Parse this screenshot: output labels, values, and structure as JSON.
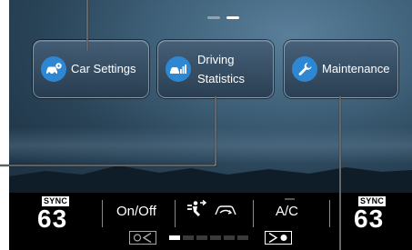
{
  "home": {
    "tiles": [
      {
        "label": "Car Settings",
        "icon": "car-gear-icon"
      },
      {
        "line1": "Driving",
        "line2": "Statistics",
        "icon": "car-bar-chart-icon"
      },
      {
        "label": "Maintenance",
        "icon": "wrench-icon"
      }
    ],
    "page_indicator": {
      "pages": 2,
      "current": 2
    }
  },
  "climate": {
    "left": {
      "sync": "SYNC",
      "temp": "63"
    },
    "right": {
      "sync": "SYNC",
      "temp": "63"
    },
    "onoff_label": "On/Off",
    "ac_label": "A/C",
    "fan_level": 0.167,
    "icons": {
      "airflow": "airflow-mode-icon",
      "recirc": "recirculation-icon",
      "fan_down": "fan-decrease-icon",
      "fan_up": "fan-increase-icon"
    }
  },
  "colors": {
    "accent_blue": "#2e87d3",
    "climate_bg": "#000000"
  }
}
